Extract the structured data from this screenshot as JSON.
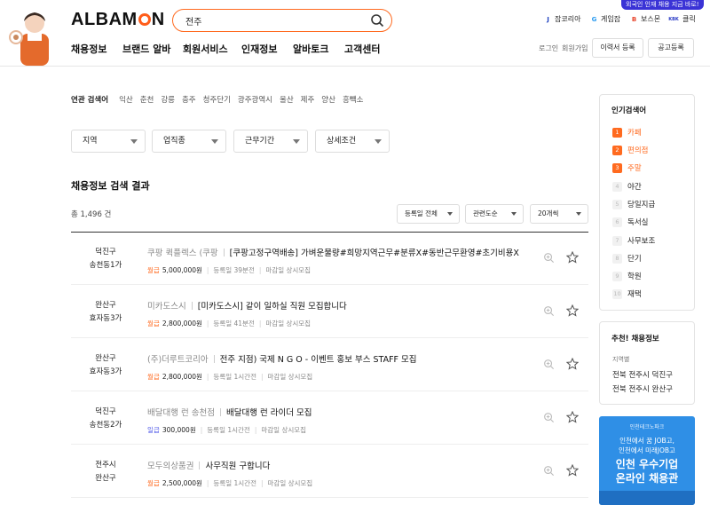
{
  "header": {
    "logo": "ALBAMON",
    "promo": "외국인 인재 채용 지금 바로!",
    "search_value": "전주",
    "family_sites": [
      {
        "label": "잡코리아",
        "icon": "J"
      },
      {
        "label": "게임잡",
        "icon": "G"
      },
      {
        "label": "보스몬",
        "icon": "B"
      },
      {
        "label": "클릭",
        "icon": "KBK"
      }
    ],
    "nav": [
      "채용정보",
      "브랜드 알바",
      "회원서비스",
      "인재정보",
      "알바토크",
      "고객센터"
    ],
    "login": "로그인",
    "signup": "회원가입",
    "resume_button": "이력서 등록",
    "post_button": "공고등록"
  },
  "related": {
    "label": "연관 검색어",
    "keywords": [
      "익산",
      "춘천",
      "강릉",
      "충주",
      "청주단기",
      "광주광역시",
      "울산",
      "제주",
      "양산",
      "흥빽소"
    ]
  },
  "filters": [
    "지역",
    "업직종",
    "근무기간",
    "상세조건"
  ],
  "results": {
    "title": "채용정보 검색 결과",
    "total": "총 1,496 건",
    "sort_options": [
      "등록일 전체",
      "관련도순",
      "20개씩"
    ]
  },
  "jobs": [
    {
      "loc1": "덕진구",
      "loc2": "송천동1가",
      "company": "쿠팡 퀵플렉스 (쿠팡",
      "title": "[쿠팡고정구역배송] 가벼운물량#희망지역근무#분류X#동반근무환영#초기비용X",
      "pay_type": "월급",
      "pay": "5,000,000원",
      "posted": "등록일 39분전",
      "deadline": "마감일 상시모집"
    },
    {
      "loc1": "완산구",
      "loc2": "효자동3가",
      "company": "미카도스시",
      "title": "[미카도스시] 같이 일하실 직원 모집합니다",
      "pay_type": "월급",
      "pay": "2,800,000원",
      "posted": "등록일 41분전",
      "deadline": "마감일 상시모집"
    },
    {
      "loc1": "완산구",
      "loc2": "효자동3가",
      "company": "(주)더루트코리아",
      "title": "전주 지점) 국제 N G O - 이벤트 홍보 부스 STAFF 모집",
      "pay_type": "월급",
      "pay": "2,800,000원",
      "posted": "등록일 1시간전",
      "deadline": "마감일 상시모집"
    },
    {
      "loc1": "덕진구",
      "loc2": "송천동2가",
      "company": "배달대행 런 송천점",
      "title": "배달대행 런 라이더 모집",
      "pay_type": "일급",
      "pay": "300,000원",
      "posted": "등록일 1시간전",
      "deadline": "마감일 상시모집"
    },
    {
      "loc1": "전주시",
      "loc2": "완산구",
      "company": "모두의상품권",
      "title": "사무직원 구합니다",
      "pay_type": "월급",
      "pay": "2,500,000원",
      "posted": "등록일 1시간전",
      "deadline": "마감일 상시모집"
    }
  ],
  "popular": {
    "title": "인기검색어",
    "items": [
      {
        "rank": "1",
        "label": "카페"
      },
      {
        "rank": "2",
        "label": "편의점"
      },
      {
        "rank": "3",
        "label": "주말"
      },
      {
        "rank": "4",
        "label": "야간"
      },
      {
        "rank": "5",
        "label": "당일지급"
      },
      {
        "rank": "6",
        "label": "독서실"
      },
      {
        "rank": "7",
        "label": "사무보조"
      },
      {
        "rank": "8",
        "label": "단기"
      },
      {
        "rank": "9",
        "label": "학원"
      },
      {
        "rank": "10",
        "label": "재택"
      }
    ]
  },
  "recommend": {
    "title": "추천! 채용정보",
    "subtitle": "지역별",
    "items": [
      "전북 전주시 덕진구",
      "전북 전주시 완산구"
    ]
  },
  "banner": {
    "brand": "인천테크노파크",
    "line1": "인천에서 꿈 JOB고,",
    "line2": "인천에서 미래JOB고",
    "line3": "인천 우수기업",
    "line4": "온라인 채용관"
  },
  "colors": {
    "accent": "#ff6a1f",
    "promo": "#3a33d6",
    "banner": "#2f8fe6",
    "daily_pay": "#4b54e8"
  }
}
